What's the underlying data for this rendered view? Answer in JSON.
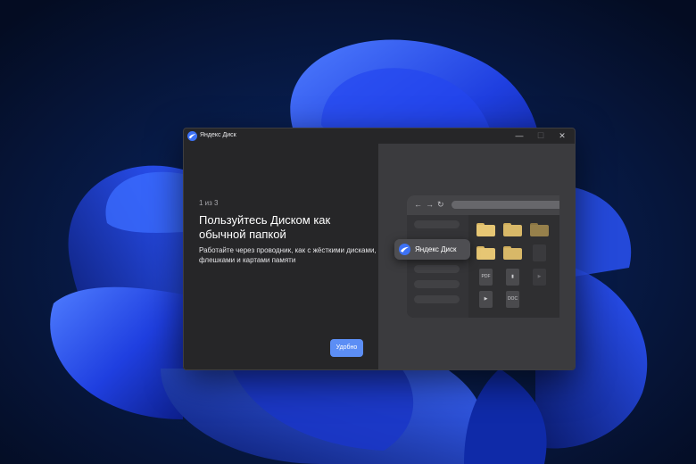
{
  "window": {
    "title": "Яндекс Диск",
    "controls": {
      "minimize": "—",
      "maximize": "☐",
      "close": "✕"
    }
  },
  "onboarding": {
    "step": "1 из 3",
    "heading": "Пользуйтесь Диском как обычной папкой",
    "description": "Работайте через проводник, как с жёсткими дисками, флешками и картами памяти",
    "cta_label": "Удобно"
  },
  "illustration": {
    "nav_icons": [
      "back-arrow-icon",
      "forward-arrow-icon",
      "refresh-icon"
    ],
    "nav_glyphs": {
      "back": "←",
      "forward": "→",
      "refresh": "↻"
    },
    "drive_label": "Яндекс Диск",
    "file_labels": {
      "pdf": "PDF",
      "doc": "DOC",
      "play": "▶",
      "zip": "▮"
    }
  },
  "colors": {
    "accent": "#5c8ef5",
    "folder": "#e0bd6a",
    "wallpaper_blue": "#1f3fe0",
    "window_bg": "#262628"
  }
}
